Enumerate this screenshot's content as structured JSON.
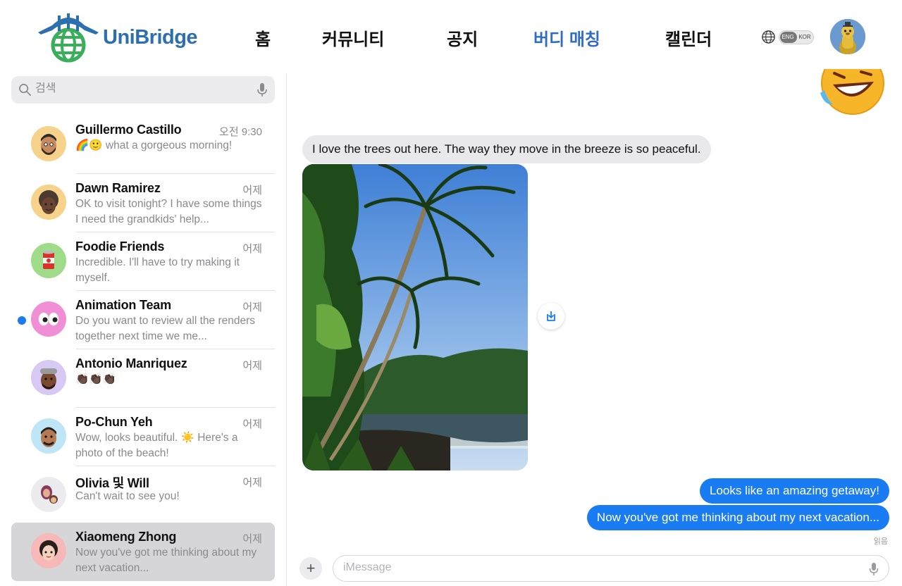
{
  "app": {
    "brand": "UniBridge",
    "accent_color": "#2f6dc4",
    "nav": [
      {
        "label": "홈"
      },
      {
        "label": "커뮤니티"
      },
      {
        "label": "공지"
      },
      {
        "label": "버디 매칭",
        "active": true
      },
      {
        "label": "캘린더"
      }
    ],
    "language": {
      "icon": "globe-icon",
      "options": [
        "ENG",
        "KOR"
      ],
      "selected": "ENG"
    },
    "user_avatar": "user-avatar"
  },
  "sidebar": {
    "search": {
      "placeholder": "검색",
      "value": ""
    },
    "conversations": [
      {
        "name": "Guillermo Castillo",
        "time": "오전 9:30",
        "preview": "🌈🙂 what a gorgeous morning!",
        "unread": false
      },
      {
        "name": "Dawn Ramirez",
        "time": "어제",
        "preview": "OK to visit tonight? I have some things I need the grandkids' help...",
        "unread": false
      },
      {
        "name": "Foodie Friends",
        "time": "어제",
        "preview": "Incredible. I'll have to try making it myself.",
        "unread": false
      },
      {
        "name": "Animation Team",
        "time": "어제",
        "preview": "Do you want to review all the renders together next time we me...",
        "unread": true
      },
      {
        "name": "Antonio Manriquez",
        "time": "어제",
        "preview": "👏🏿👏🏿👏🏿",
        "unread": false
      },
      {
        "name": "Po-Chun Yeh",
        "time": "어제",
        "preview": "Wow, looks beautiful. ☀️ Here's a photo of the beach!",
        "unread": false
      },
      {
        "name": "Olivia 및 Will",
        "time": "어제",
        "preview": "Can't wait to see you!",
        "unread": false
      },
      {
        "name": "Xiaomeng Zhong",
        "time": "어제",
        "preview": "Now you've got me thinking about my next vacation...",
        "unread": false,
        "selected": true
      }
    ]
  },
  "chat": {
    "incoming_text": "I love the trees out here. The way they move in the breeze is so peaceful.",
    "photo": "palm-trees-photo",
    "outgoing": [
      "Looks like an amazing getaway!",
      "Now you've got me thinking about my next vacation..."
    ],
    "read_receipt": "읽음",
    "composer": {
      "placeholder": "iMessage",
      "value": ""
    },
    "colors": {
      "outgoing_bubble": "#1a7cf2",
      "incoming_bubble": "#e9e9eb"
    }
  }
}
